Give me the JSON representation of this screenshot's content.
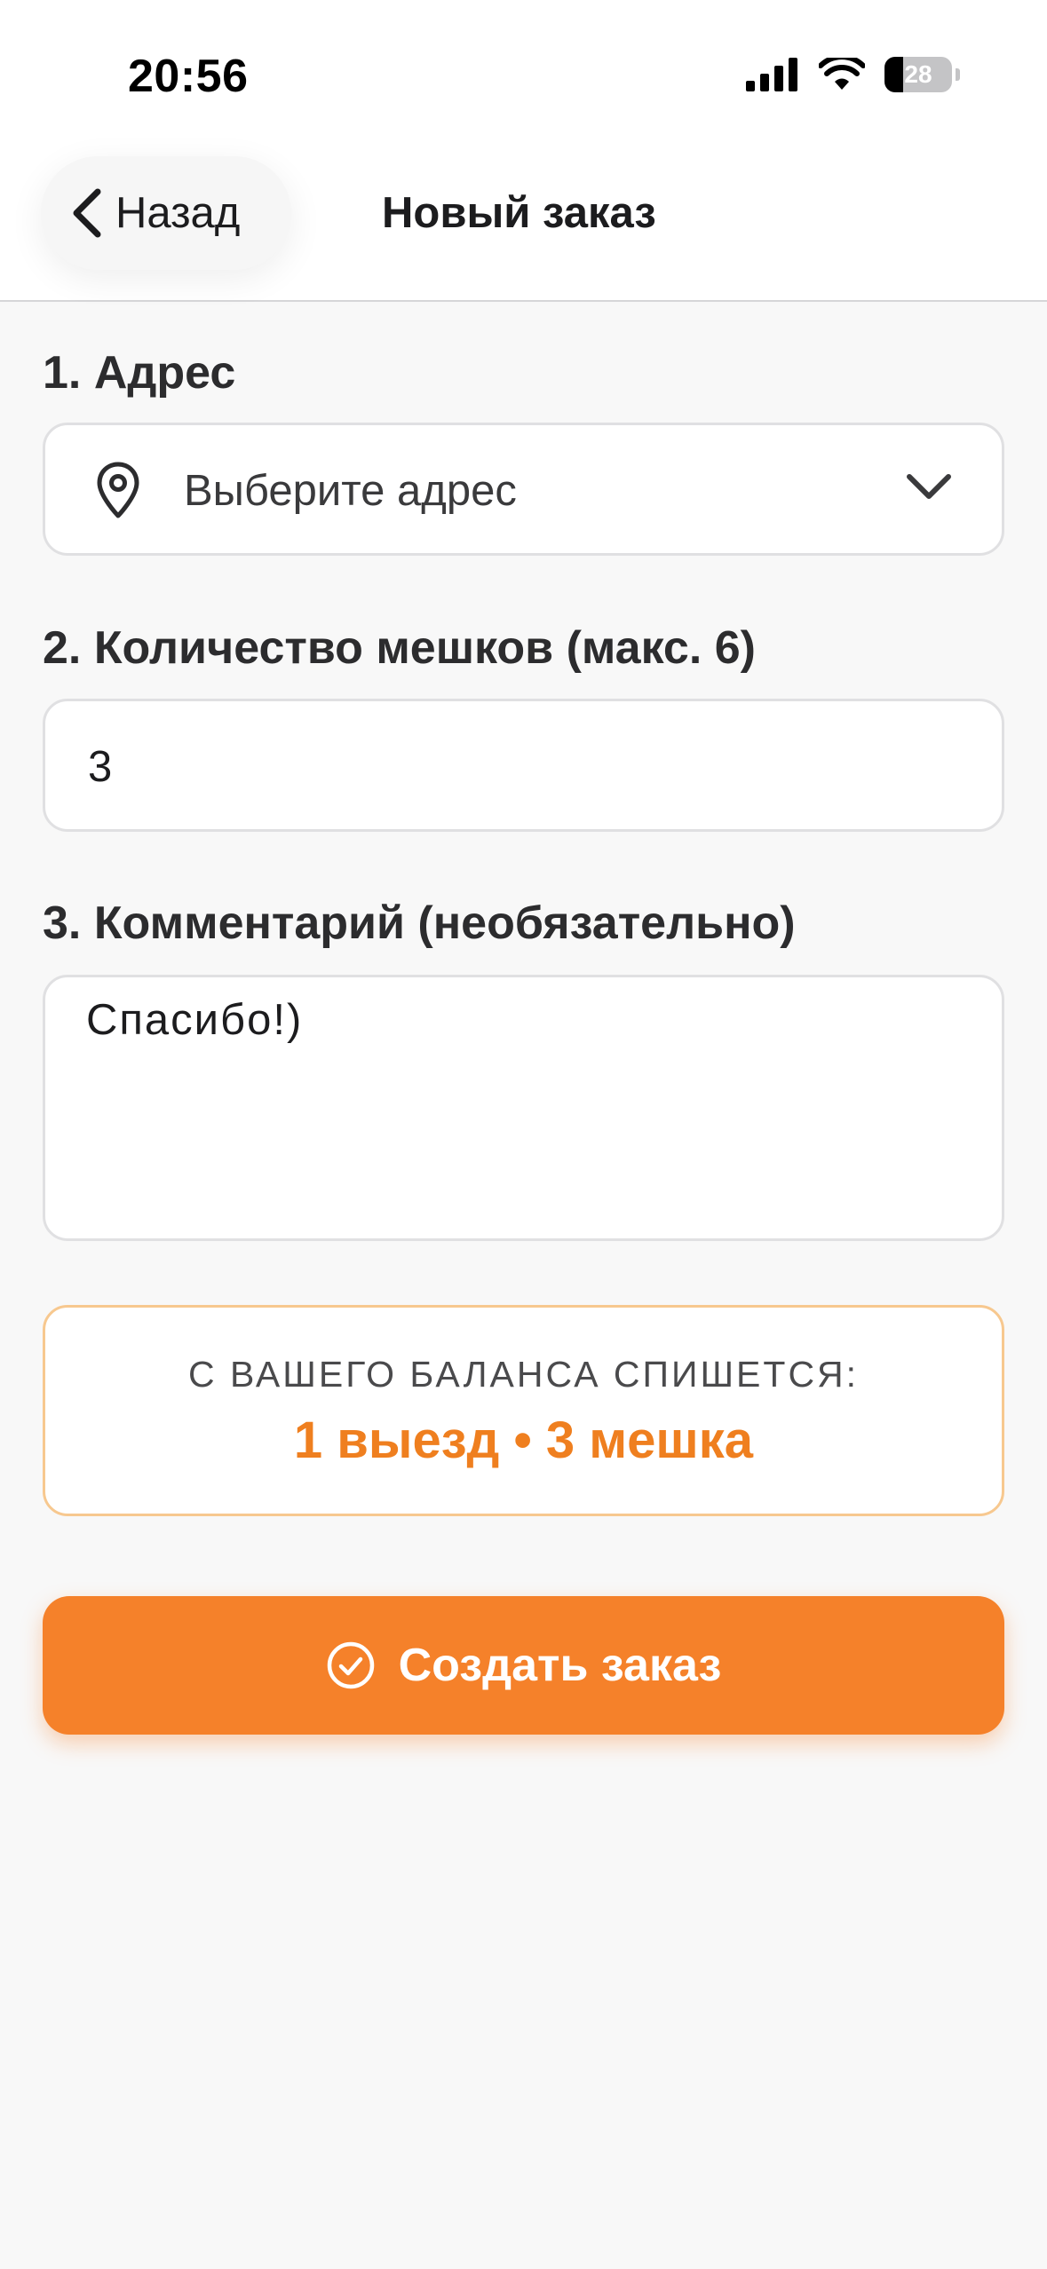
{
  "status_bar": {
    "time": "20:56",
    "battery": "28",
    "icons": [
      "cellular-signal-icon",
      "wifi-icon",
      "battery-icon"
    ]
  },
  "nav": {
    "back_label": "Назад",
    "title": "Новый заказ"
  },
  "form": {
    "address": {
      "label": "1. Адрес",
      "placeholder": "Выберите адрес",
      "icons": [
        "location-pin-icon",
        "chevron-down-icon"
      ]
    },
    "bags": {
      "label": "2. Количество мешков (макс. 6)",
      "value": "3"
    },
    "comment": {
      "label": "3. Комментарий (необязательно)",
      "value": "Спасибо!)"
    }
  },
  "summary": {
    "caption": "С ВАШЕГО БАЛАНСА СПИШЕТСЯ:",
    "value": "1 выезд • 3 мешка"
  },
  "actions": {
    "create_label": "Создать заказ",
    "create_icon": "check-circle-icon"
  },
  "colors": {
    "accent": "#F5812A",
    "accent_text": "#EF7F1F",
    "summary_border": "#F7C88F",
    "background": "#F8F8F8"
  }
}
